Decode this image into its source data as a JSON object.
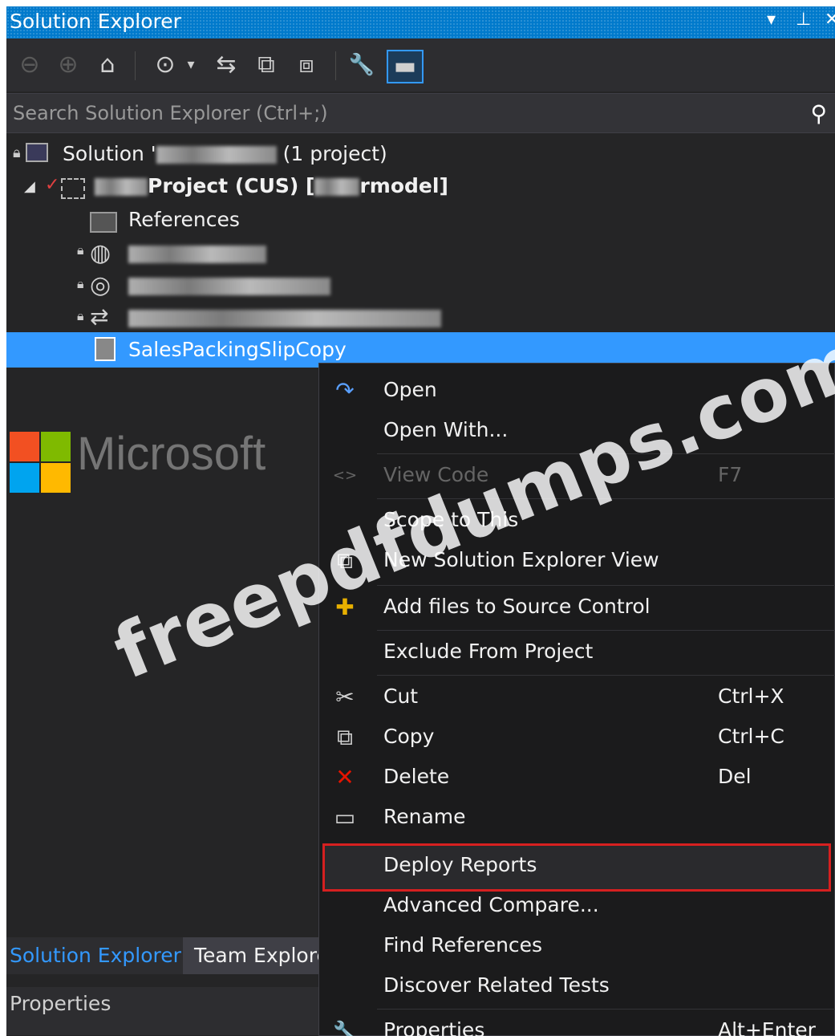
{
  "window": {
    "title": "Solution Explorer",
    "controls": [
      "▾",
      "⊥",
      "✕"
    ]
  },
  "toolbar": {
    "buttons": [
      {
        "name": "back-icon",
        "glyph": "⊖"
      },
      {
        "name": "forward-icon",
        "glyph": "⊕"
      },
      {
        "name": "home-icon",
        "glyph": "⌂"
      },
      {
        "name": "pending-changes-icon",
        "glyph": "⊙"
      },
      {
        "name": "sync-icon",
        "glyph": "⇆"
      },
      {
        "name": "collapse-all-icon",
        "glyph": "⧉"
      },
      {
        "name": "show-all-files-icon",
        "glyph": "⧈"
      },
      {
        "name": "properties-wrench-icon",
        "glyph": "🔧"
      },
      {
        "name": "preview-icon",
        "glyph": "▬"
      }
    ]
  },
  "search": {
    "placeholder": "Search Solution Explorer (Ctrl+;)"
  },
  "tree": {
    "solution_prefix": "Solution '",
    "solution_suffix": " (1 project)",
    "project_label": "Project (CUS) [",
    "project_suffix": "rmodel]",
    "references": "References",
    "selected_item": "SalesPackingSlipCopy"
  },
  "logo": {
    "text": "Microsoft",
    "colors": [
      "#f25022",
      "#7fba00",
      "#00a4ef",
      "#ffb900"
    ]
  },
  "bottom_tabs": [
    {
      "label": "Solution Explorer",
      "active": true
    },
    {
      "label": "Team Explore",
      "active": false
    }
  ],
  "properties": {
    "label": "Properties"
  },
  "context_menu": {
    "items": [
      {
        "label": "Open",
        "shortcut": "",
        "icon": "↷",
        "icon_name": "open-icon"
      },
      {
        "label": "Open With...",
        "shortcut": "",
        "icon": "",
        "icon_name": ""
      },
      {
        "label": "View Code",
        "shortcut": "F7",
        "icon": "<>",
        "icon_name": "view-code-icon",
        "disabled": true
      },
      {
        "label": "Scope to This",
        "shortcut": "",
        "icon": "",
        "icon_name": ""
      },
      {
        "label": "New Solution Explorer View",
        "shortcut": "",
        "icon": "⧉",
        "icon_name": "new-view-icon"
      },
      {
        "label": "Add files to Source Control",
        "shortcut": "",
        "icon": "✚",
        "icon_name": "add-source-control-icon"
      },
      {
        "label": "Exclude From Project",
        "shortcut": "",
        "icon": "",
        "icon_name": ""
      },
      {
        "label": "Cut",
        "shortcut": "Ctrl+X",
        "icon": "✂",
        "icon_name": "cut-icon"
      },
      {
        "label": "Copy",
        "shortcut": "Ctrl+C",
        "icon": "⧉",
        "icon_name": "copy-icon"
      },
      {
        "label": "Delete",
        "shortcut": "Del",
        "icon": "✕",
        "icon_name": "delete-icon"
      },
      {
        "label": "Rename",
        "shortcut": "",
        "icon": "▭",
        "icon_name": "rename-icon"
      },
      {
        "label": "Deploy Reports",
        "shortcut": "",
        "icon": "",
        "icon_name": "",
        "highlighted": true
      },
      {
        "label": "Advanced Compare...",
        "shortcut": "",
        "icon": "",
        "icon_name": ""
      },
      {
        "label": "Find References",
        "shortcut": "",
        "icon": "",
        "icon_name": ""
      },
      {
        "label": "Discover Related Tests",
        "shortcut": "",
        "icon": "",
        "icon_name": ""
      },
      {
        "label": "Properties",
        "shortcut": "Alt+Enter",
        "icon": "🔧",
        "icon_name": "properties-icon"
      }
    ]
  },
  "watermark": "freepdfdumps.com",
  "colors": {
    "accent": "#007acc",
    "selection": "#3399ff",
    "highlight_border": "#d62020",
    "delete": "#e51400"
  }
}
